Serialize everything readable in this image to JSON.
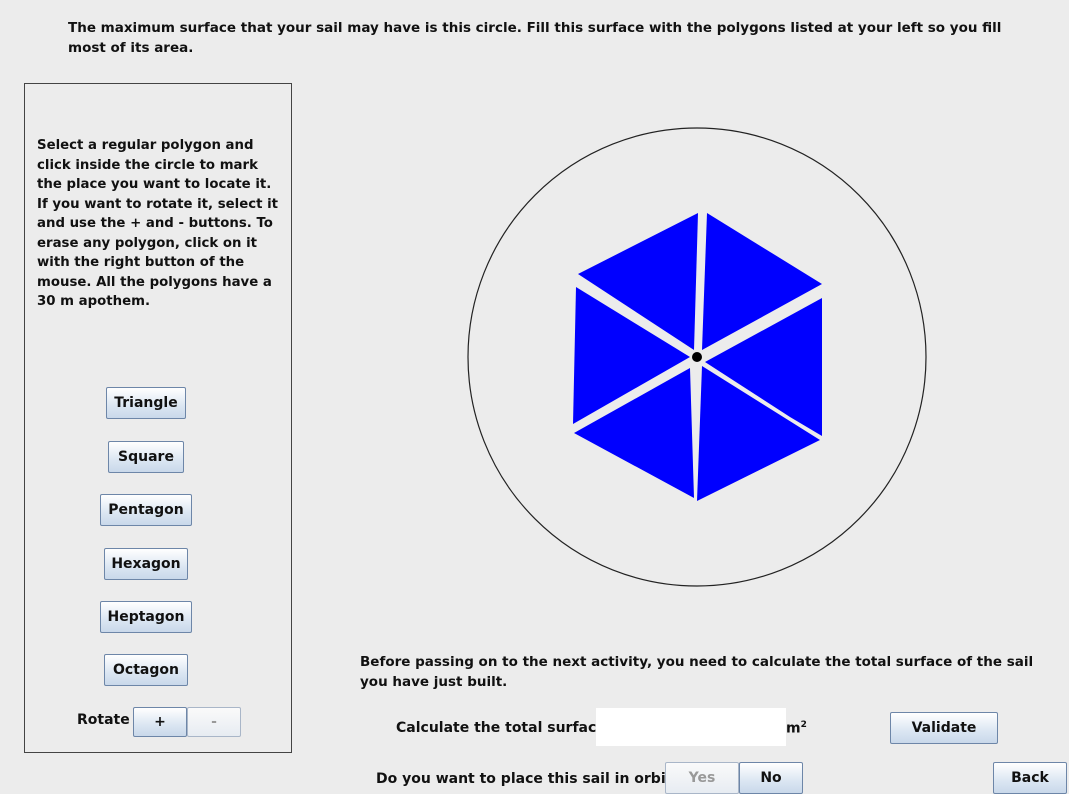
{
  "instructions": "The maximum surface that your sail may have is this circle. Fill this surface with the polygons listed at your left so you fill most of its area.",
  "help_text": "Select a regular polygon and click inside the circle to mark the place you want to locate it. If you want to rotate it, select it and use the + and - buttons. To erase any polygon, click on it with the right button of the mouse. All the polygons have a 30 m apothem.",
  "polygon_buttons": {
    "triangle": "Triangle",
    "square": "Square",
    "pentagon": "Pentagon",
    "hexagon": "Hexagon",
    "heptagon": "Heptagon",
    "octagon": "Octagon"
  },
  "rotate": {
    "label": "Rotate",
    "plus": "+",
    "minus": "-"
  },
  "calc_text": "Before passing on to the next activity, you need to calculate the total surface of the sail you have just built.",
  "surface": {
    "label": "Calculate the total surface",
    "value": "",
    "unit": "m",
    "unit_exp": "2"
  },
  "validate_label": "Validate",
  "orbit": {
    "question": "Do you want to place this sail in orbit?",
    "yes": "Yes",
    "no": "No"
  },
  "back_label": "Back",
  "colors": {
    "polygon_fill": "#0000ff",
    "background": "#ececec"
  }
}
